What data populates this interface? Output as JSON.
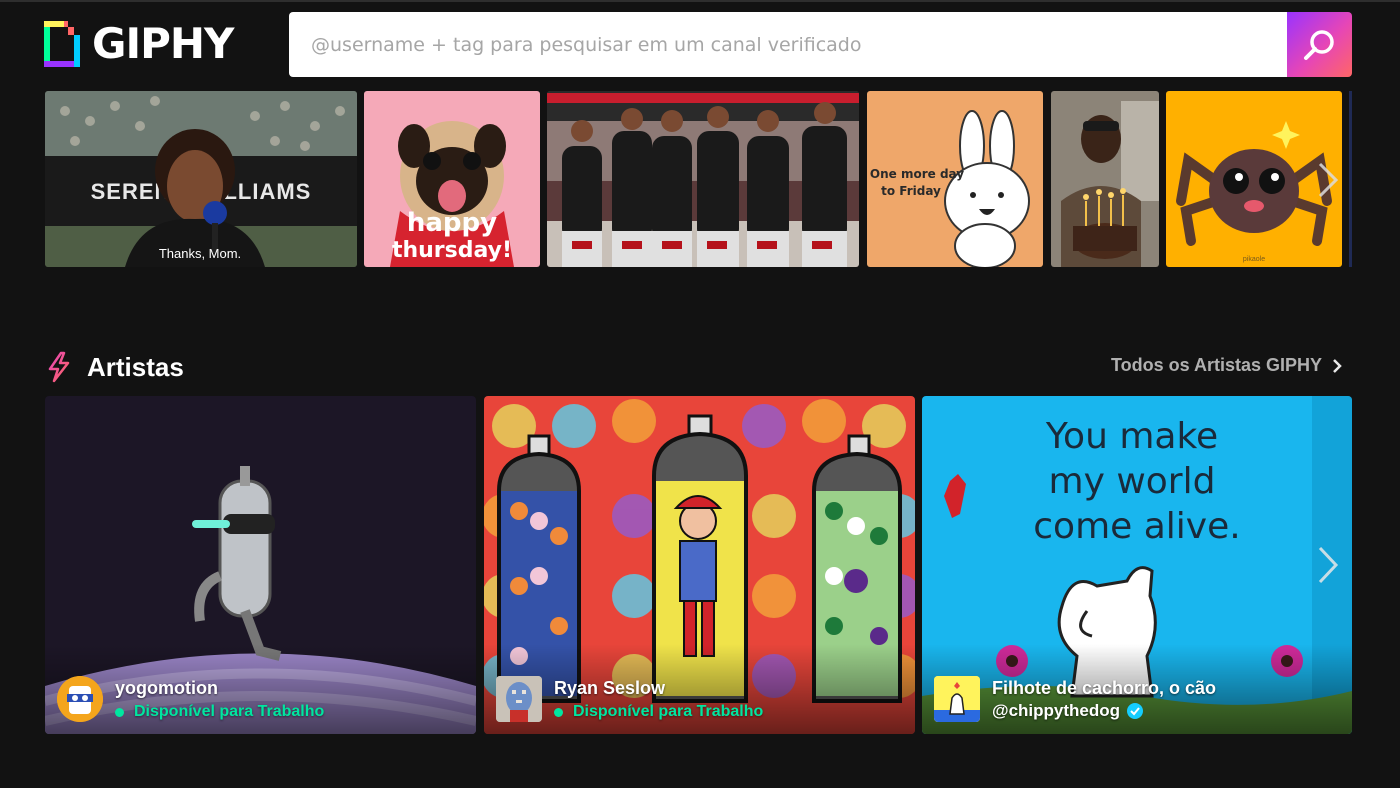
{
  "header": {
    "logo_text": "GIPHY",
    "search_placeholder": "@username + tag para pesquisar em um canal verificado"
  },
  "trending": {
    "items": [
      {
        "name": "serena-williams",
        "text_banner": "SERENA WILLIAMS",
        "caption": "Thanks, Mom."
      },
      {
        "name": "happy-thursday-pug",
        "line1": "happy",
        "line2": "thursday!"
      },
      {
        "name": "basketball-team"
      },
      {
        "name": "one-more-day-bunny",
        "line1": "One more day",
        "line2": "to Friday"
      },
      {
        "name": "birthday-cake"
      },
      {
        "name": "cute-spider",
        "small_text": "pikaole"
      }
    ]
  },
  "artists": {
    "title": "Artistas",
    "all_link": "Todos os Artistas GIPHY",
    "cards": [
      {
        "name": "yogomotion",
        "status": "Disponível para Trabalho"
      },
      {
        "name": "Ryan Seslow",
        "status": "Disponível para Trabalho"
      },
      {
        "name": "Filhote de cachorro, o cão",
        "handle": "@chippythedog",
        "gif_text_1": "You make",
        "gif_text_2": "my world",
        "gif_text_3": "come alive."
      }
    ]
  },
  "colors": {
    "background": "#121212",
    "accent_gradient_start": "#9933ff",
    "accent_gradient_end": "#ff6666",
    "available_green": "#00e6a0",
    "verified_blue": "#15cdff"
  }
}
